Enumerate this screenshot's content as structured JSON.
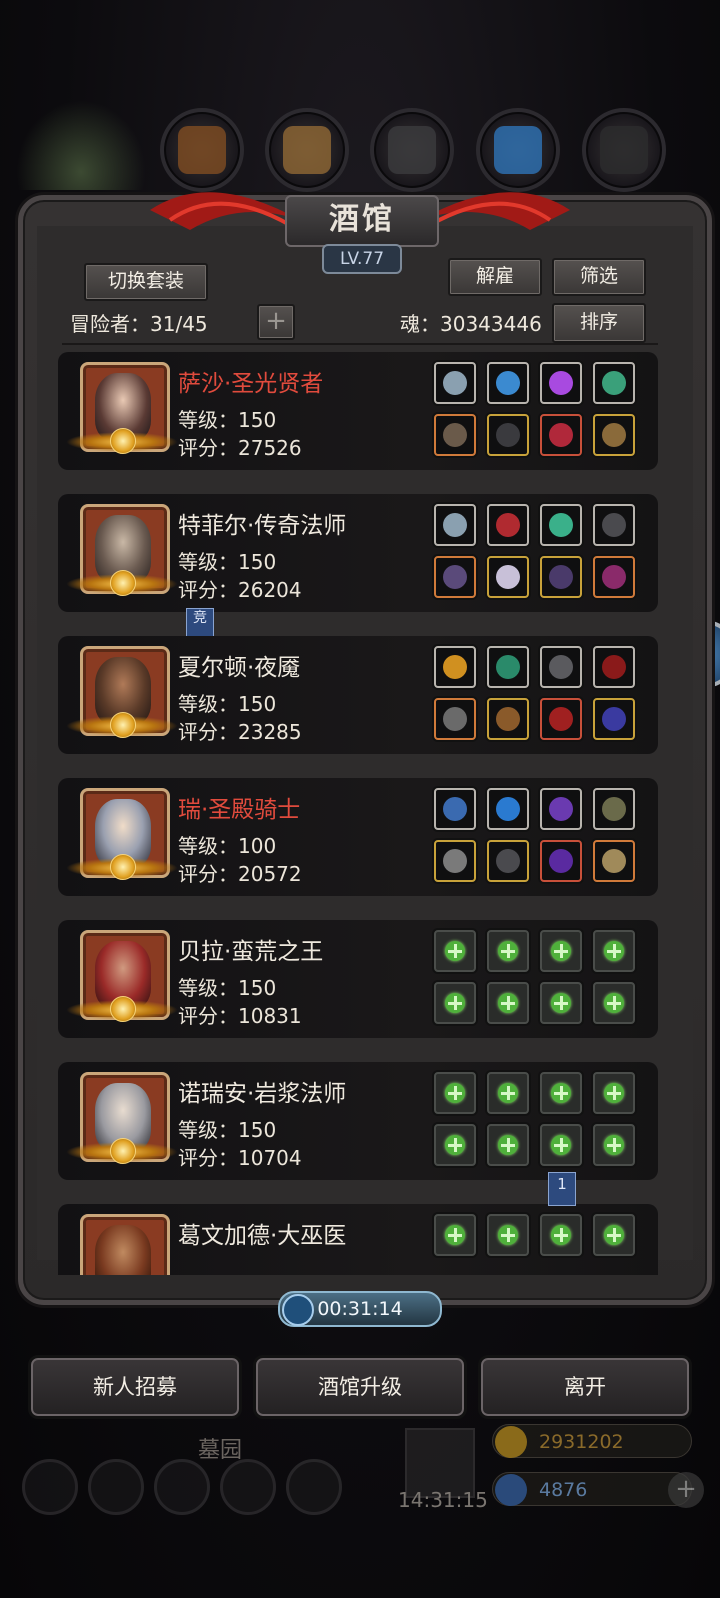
{
  "title": "酒馆",
  "level": "LV.77",
  "buttons": {
    "switch_outfit": "切换套装",
    "dismiss": "解雇",
    "filter": "筛选",
    "sort": "排序",
    "add": "+"
  },
  "adventurers": {
    "label": "冒险者：",
    "value": "31/45"
  },
  "soul": {
    "label": "魂：",
    "value": "30343446"
  },
  "heroes": [
    {
      "name": "萨沙·圣光贤者",
      "name_color": "red",
      "level": "等级：150",
      "score": "评分：27526",
      "equip": "full"
    },
    {
      "name": "特菲尔·传奇法师",
      "name_color": "white",
      "level": "等级：150",
      "score": "评分：26204",
      "equip": "full",
      "badge": "竞"
    },
    {
      "name": "夏尔顿·夜魇",
      "name_color": "white",
      "level": "等级：150",
      "score": "评分：23285",
      "equip": "full"
    },
    {
      "name": "瑞·圣殿骑士",
      "name_color": "red",
      "level": "等级：100",
      "score": "评分：20572",
      "equip": "full"
    },
    {
      "name": "贝拉·蛮荒之王",
      "name_color": "white",
      "level": "等级：150",
      "score": "评分：10831",
      "equip": "empty"
    },
    {
      "name": "诺瑞安·岩浆法师",
      "name_color": "white",
      "level": "等级：150",
      "score": "评分：10704",
      "equip": "empty"
    },
    {
      "name": "葛文加德·大巫医",
      "name_color": "white",
      "level": "",
      "score": "",
      "equip": "empty"
    }
  ],
  "page_flag": "1",
  "timer": "00:31:14",
  "bottom_buttons": {
    "recruit": "新人招募",
    "upgrade": "酒馆升级",
    "leave": "离开"
  },
  "hud": {
    "area_name": "墓园",
    "clock": "14:31:15",
    "gold": "2931202",
    "gems": "4876"
  }
}
